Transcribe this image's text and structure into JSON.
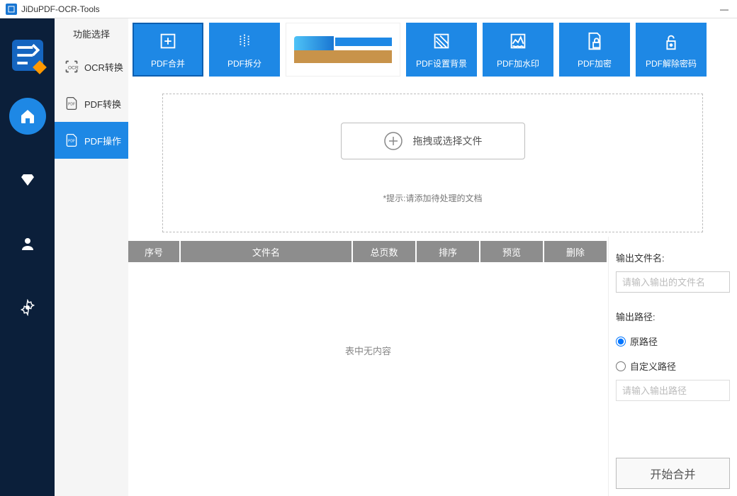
{
  "window": {
    "title": "JiDuPDF-OCR-Tools"
  },
  "sidebar": {
    "header": "功能选择",
    "items": [
      {
        "label": "OCR转换"
      },
      {
        "label": "PDF转换"
      },
      {
        "label": "PDF操作"
      }
    ]
  },
  "toolbar": {
    "merge": "PDF合并",
    "split": "PDF拆分",
    "background": "PDF设置背景",
    "watermark": "PDF加水印",
    "encrypt": "PDF加密",
    "decrypt": "PDF解除密码"
  },
  "dropzone": {
    "button": "拖拽或选择文件",
    "hint": "*提示:请添加待处理的文档"
  },
  "table": {
    "headers": {
      "sn": "序号",
      "name": "文件名",
      "pages": "总页数",
      "sort": "排序",
      "view": "预览",
      "del": "删除"
    },
    "empty": "表中无内容"
  },
  "output": {
    "filename_label": "输出文件名:",
    "filename_placeholder": "请输入输出的文件名",
    "path_label": "输出路径:",
    "radio_original": "原路径",
    "radio_custom": "自定义路径",
    "custom_placeholder": "请输入输出路径",
    "start_button": "开始合并"
  }
}
